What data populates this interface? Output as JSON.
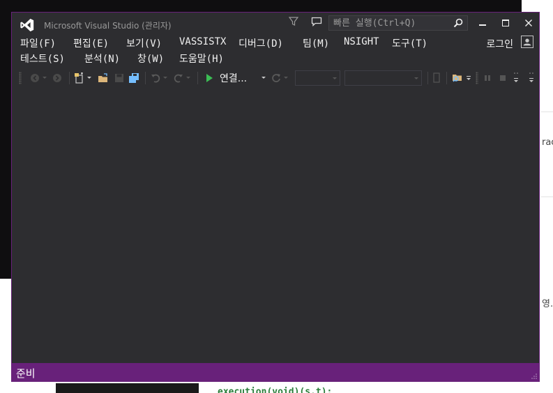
{
  "background": {
    "right_fragment_1": "rac",
    "right_fragment_2": "영.",
    "bottom_text": "execution(void)(s.t);"
  },
  "window": {
    "title": "Microsoft Visual Studio (관리자)",
    "quick_launch_placeholder": "빠른 실행(Ctrl+Q)",
    "login": "로그인",
    "accent_color": "#68217a"
  },
  "menu": {
    "row1": [
      "파일(F)",
      "편집(E)",
      "보기(V)",
      "VASSISTX",
      "디버그(D)",
      "팀(M)",
      "NSIGHT",
      "도구(T)"
    ],
    "row2": [
      "테스트(S)",
      "분석(N)",
      "창(W)",
      "도움말(H)"
    ]
  },
  "toolbar": {
    "attach_label": "연결..."
  },
  "status": {
    "text": "준비"
  }
}
